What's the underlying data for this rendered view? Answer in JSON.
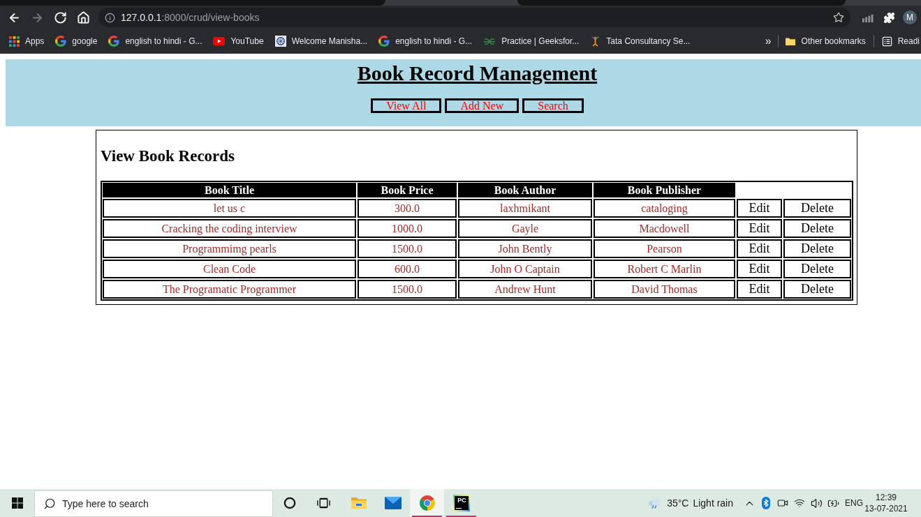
{
  "browser": {
    "nav": [
      {
        "kind": "back",
        "disabled": false
      },
      {
        "kind": "forward",
        "disabled": true
      },
      {
        "kind": "reload",
        "disabled": false
      },
      {
        "kind": "home",
        "disabled": false
      }
    ],
    "address": {
      "host": "127.0.0.1",
      "path": ":8000/crud/view-books"
    },
    "profile": "M",
    "bookmarks": [
      {
        "kind": "apps",
        "label": "Apps"
      },
      {
        "kind": "g-logo",
        "label": "google"
      },
      {
        "kind": "g-logo",
        "label": "english to hindi - G..."
      },
      {
        "kind": "play-logo",
        "label": "YouTube"
      },
      {
        "kind": "emblem",
        "label": "Welcome Manisha..."
      },
      {
        "kind": "g-logo",
        "label": "english to hindi - G..."
      },
      {
        "kind": "gg-logo",
        "label": "Practice | Geeksfor..."
      },
      {
        "kind": "figure-logo",
        "label": "Tata Consultancy Se..."
      }
    ],
    "overflow": "»",
    "bookmarks_right": [
      {
        "kind": "folder",
        "label": "Other bookmarks"
      },
      {
        "kind": "list",
        "label": "Readi"
      }
    ]
  },
  "header": {
    "title": "Book Record Management",
    "nav": [
      "View All",
      "Add New",
      "Search"
    ]
  },
  "records": {
    "heading": "View Book Records",
    "columns": [
      "Book Title",
      "Book Price",
      "Book Author",
      "Book Publisher"
    ],
    "rows": [
      {
        "cells": [
          "let us c",
          "300.0",
          "laxhmikant",
          "cataloging"
        ],
        "actions": [
          "Edit",
          "Delete"
        ]
      },
      {
        "cells": [
          "Cracking the coding interview",
          "1000.0",
          "Gayle",
          "Macdowell"
        ],
        "actions": [
          "Edit",
          "Delete"
        ]
      },
      {
        "cells": [
          "Programmimg pearls",
          "1500.0",
          "John Bently",
          "Pearson"
        ],
        "actions": [
          "Edit",
          "Delete"
        ]
      },
      {
        "cells": [
          "Clean Code",
          "600.0",
          "John O Captain",
          "Robert C Marlin"
        ],
        "actions": [
          "Edit",
          "Delete"
        ]
      },
      {
        "cells": [
          "The Programatic Programmer",
          "1500.0",
          "Andrew Hunt",
          "David Thomas"
        ],
        "actions": [
          "Edit",
          "Delete"
        ]
      }
    ]
  },
  "taskbar": {
    "search_placeholder": "Type here to search",
    "apps": [
      {
        "kind": "file-explorer",
        "running": false,
        "selected": false
      },
      {
        "kind": "mail",
        "running": false,
        "selected": false
      },
      {
        "kind": "chrome",
        "running": true,
        "selected": true
      },
      {
        "kind": "pc-tile",
        "label": "PC",
        "running": true,
        "selected": false
      }
    ],
    "weather": {
      "temperature": "35°C",
      "condition": "Light rain"
    },
    "language": "ENG",
    "time": "12:39",
    "date": "13-07-2021"
  }
}
